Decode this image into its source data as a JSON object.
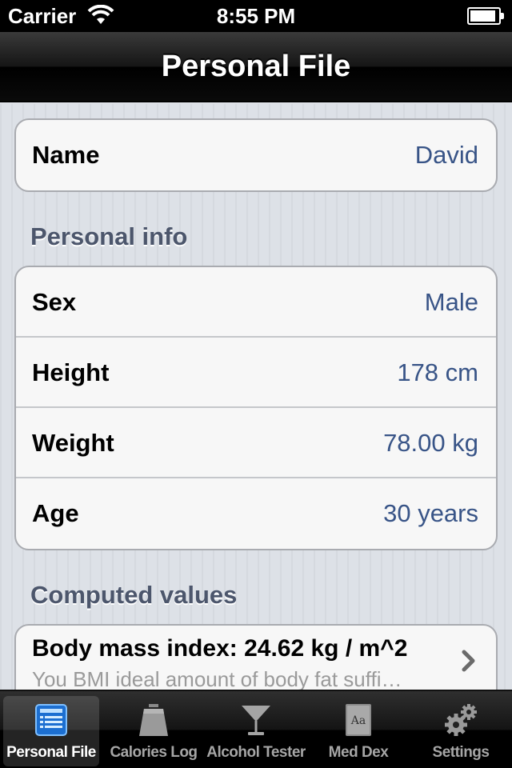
{
  "status_bar": {
    "carrier": "Carrier",
    "time": "8:55 PM",
    "battery_level": 0.9
  },
  "nav": {
    "title": "Personal File"
  },
  "name_row": {
    "label": "Name",
    "value": "David"
  },
  "personal_info": {
    "header": "Personal info",
    "rows": [
      {
        "label": "Sex",
        "value": "Male"
      },
      {
        "label": "Height",
        "value": "178 cm"
      },
      {
        "label": "Weight",
        "value": "78.00 kg"
      },
      {
        "label": "Age",
        "value": "30 years"
      }
    ]
  },
  "computed": {
    "header": "Computed values",
    "bmi_title": "Body mass index: 24.62 kg / m^2",
    "bmi_subtitle": "You BMI ideal amount of body fat suffi…"
  },
  "tabs": [
    {
      "label": "Personal File",
      "icon": "list-icon",
      "active": true
    },
    {
      "label": "Calories Log",
      "icon": "scale-icon",
      "active": false
    },
    {
      "label": "Alcohol Tester",
      "icon": "cocktail-glass-icon",
      "active": false
    },
    {
      "label": "Med Dex",
      "icon": "dictionary-book-icon",
      "active": false
    },
    {
      "label": "Settings",
      "icon": "gears-icon",
      "active": false
    }
  ],
  "colors": {
    "value_blue": "#385487",
    "section_header": "#4c566c",
    "active_tab_icon": "#2f8fe8"
  }
}
